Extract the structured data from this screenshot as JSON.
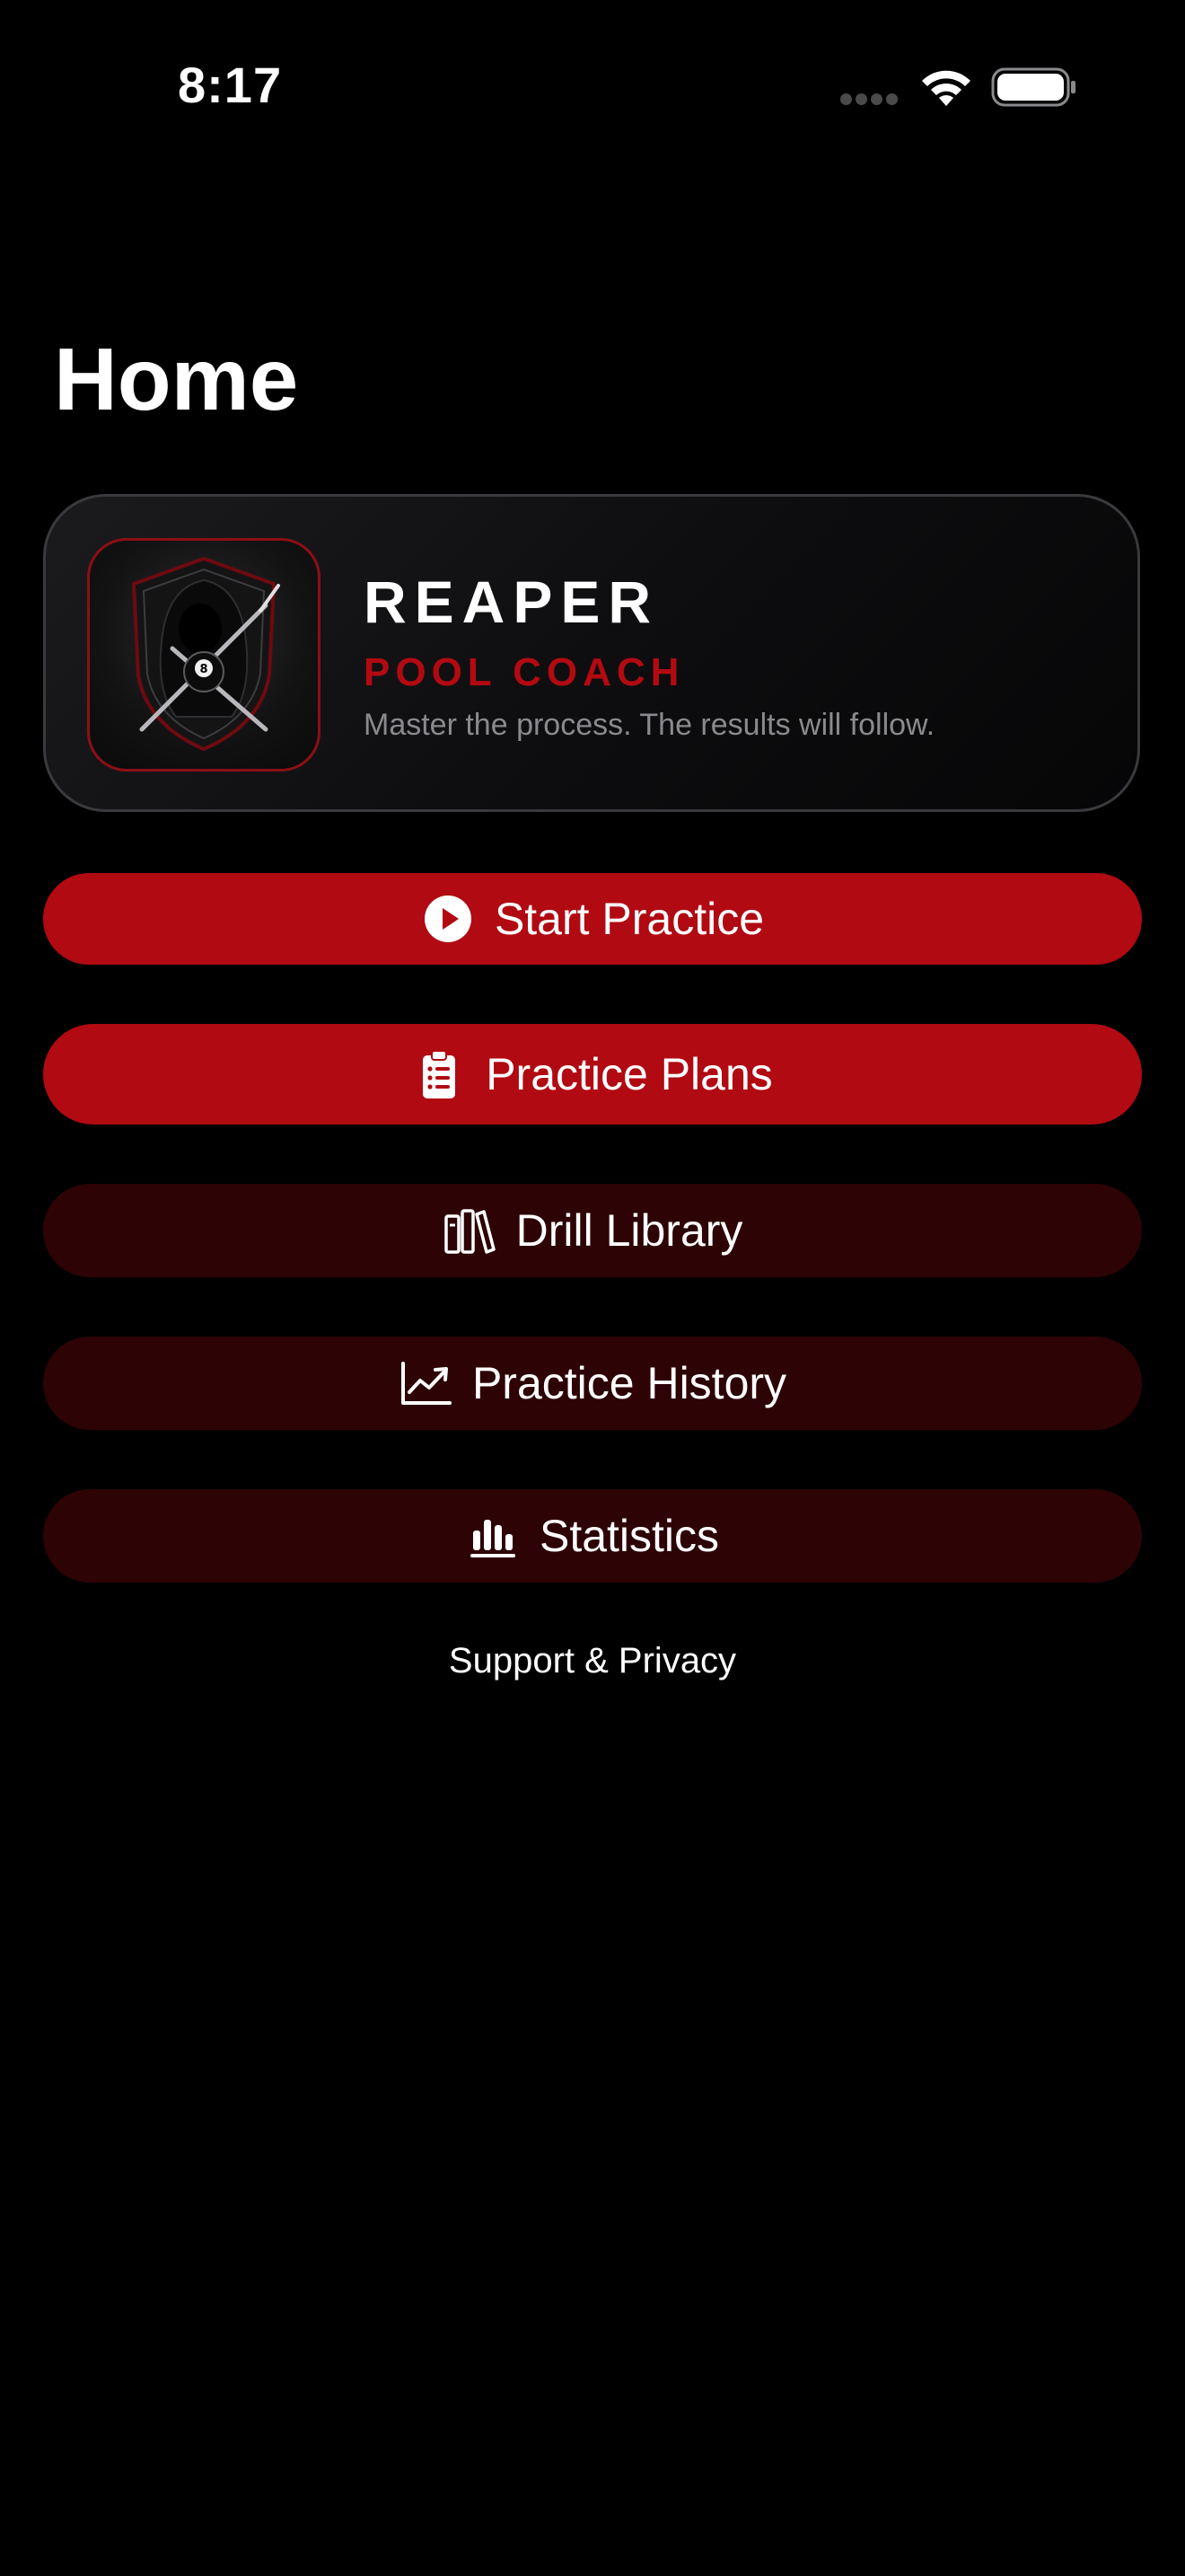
{
  "status_bar": {
    "time": "8:17",
    "signal_icon": "cellular-signal-icon",
    "wifi_icon": "wifi-icon",
    "battery_icon": "battery-full-icon"
  },
  "page": {
    "title": "Home"
  },
  "hero": {
    "logo_icon": "reaper-eight-ball-shield-logo",
    "brand_name": "REAPER",
    "brand_sub": "POOL COACH",
    "tagline": "Master the process. The results will follow."
  },
  "menu": {
    "start_practice": {
      "label": "Start Practice",
      "icon": "play-circle-icon"
    },
    "practice_plans": {
      "label": "Practice Plans",
      "icon": "clipboard-list-icon"
    },
    "drill_library": {
      "label": "Drill Library",
      "icon": "books-icon"
    },
    "practice_history": {
      "label": "Practice History",
      "icon": "trend-chart-icon"
    },
    "statistics": {
      "label": "Statistics",
      "icon": "bar-chart-icon"
    }
  },
  "footer": {
    "support_link": "Support & Privacy"
  },
  "colors": {
    "background": "#000000",
    "accent_primary": "#b10a12",
    "accent_dark": "#2d0306",
    "brand_red": "#b30a12",
    "muted_text": "#8a8a8e"
  }
}
